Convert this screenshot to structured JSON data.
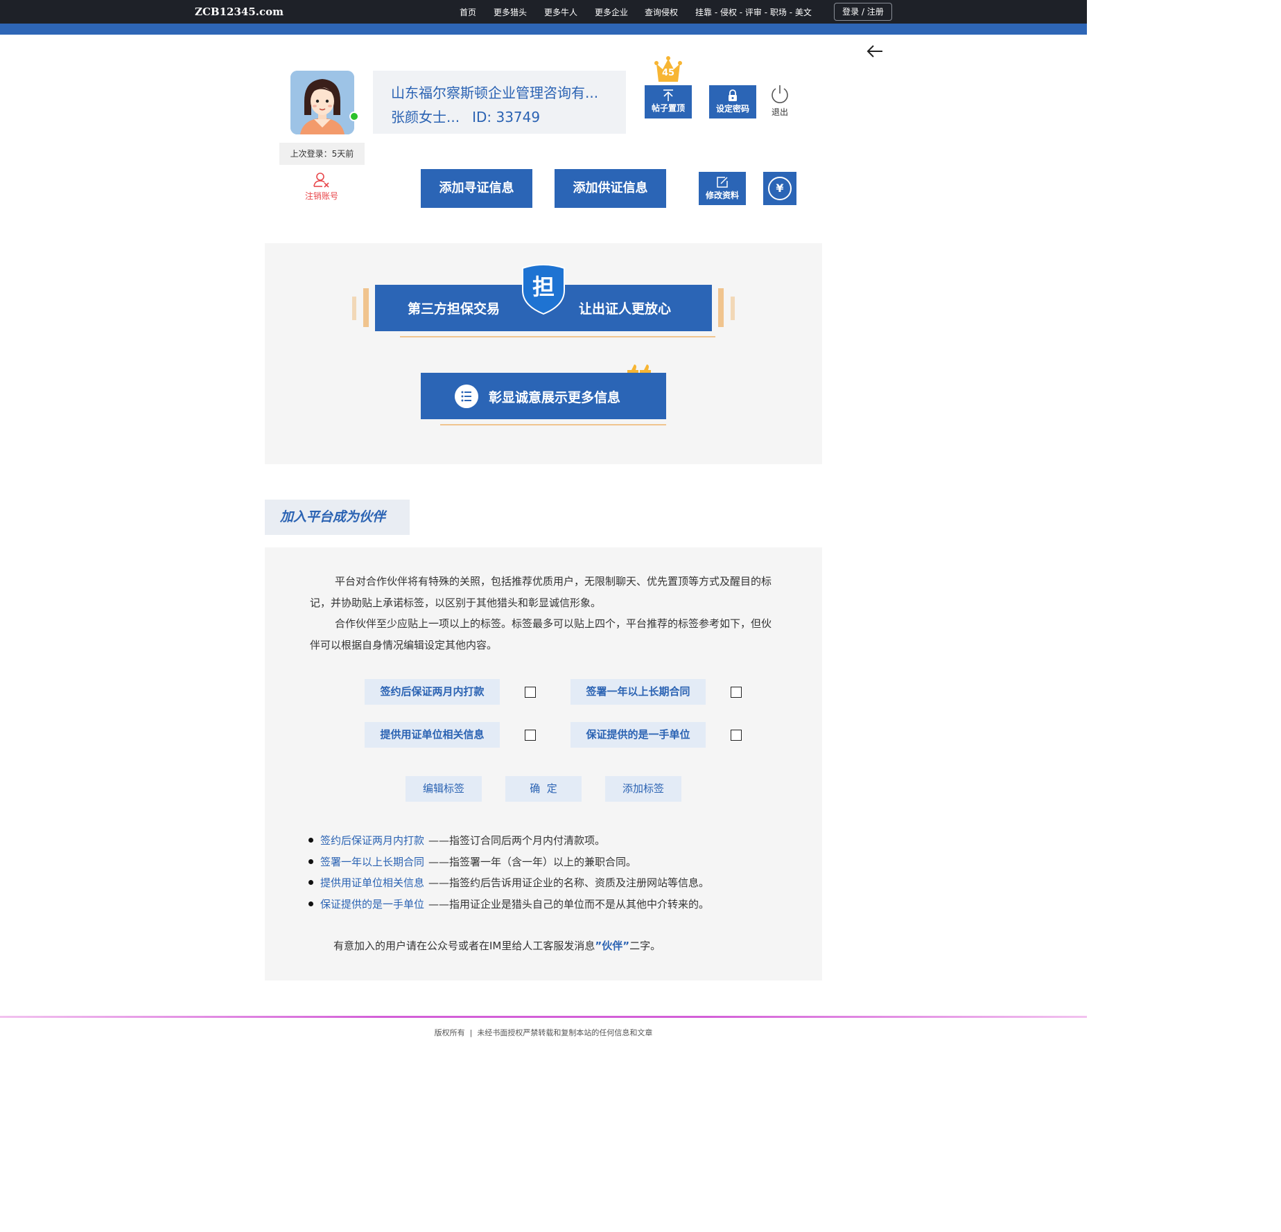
{
  "nav": {
    "logo": "ZCB12345.com",
    "items": [
      "首页",
      "更多猎头",
      "更多牛人",
      "更多企业",
      "查询侵权",
      "挂靠 - 侵权 - 评审 - 职场 - 美文"
    ],
    "login": "登录 / 注册"
  },
  "profile": {
    "company": "山东福尔察斯顿企业管理咨询有...",
    "person": "张颜女士...",
    "id": "ID: 33749",
    "last_login": "上次登录：5天前",
    "cancel_account": "注销账号",
    "crown_level": "45",
    "pin_post": "帖子置顶",
    "set_password": "设定密码",
    "logout": "退出",
    "add_seek": "添加寻证信息",
    "add_supply": "添加供证信息",
    "edit_profile": "修改资料",
    "yuan_icon": "¥"
  },
  "guarantee": {
    "left": "第三方担保交易",
    "shield_char": "担",
    "right": "让出证人更放心",
    "more_info": "彰显诚意展示更多信息"
  },
  "partner": {
    "title": "加入平台成为伙伴",
    "para1": "平台对合作伙伴将有特殊的关照，包括推荐优质用户，无限制聊天、优先置顶等方式及醒目的标记，并协助贴上承诺标签，以区别于其他猎头和彰显诚信形象。",
    "para2": "合作伙伴至少应贴上一项以上的标签。标签最多可以贴上四个，平台推荐的标签参考如下，但伙伴可以根据自身情况编辑设定其他内容。",
    "tags": [
      "签约后保证两月内打款",
      "签署一年以上长期合同",
      "提供用证单位相关信息",
      "保证提供的是一手单位"
    ],
    "buttons": [
      "编辑标签",
      "确  定",
      "添加标签"
    ],
    "definitions": [
      {
        "term": "签约后保证两月内打款",
        "desc": "——指签订合同后两个月内付清款项。"
      },
      {
        "term": "签署一年以上长期合同",
        "desc": "——指签署一年（含一年）以上的兼职合同。"
      },
      {
        "term": "提供用证单位相关信息",
        "desc": "——指签约后告诉用证企业的名称、资质及注册网站等信息。"
      },
      {
        "term": "保证提供的是一手单位",
        "desc": "——指用证企业是猎头自己的单位而不是从其他中介转来的。"
      }
    ],
    "contact_before": "有意加入的用户请在公众号或者在IM里给人工客服发消息",
    "contact_keyword": "”伙伴”",
    "contact_after": "二字。"
  },
  "footer": {
    "text": "版权所有  |  未经书面授权严禁转载和复制本站的任何信息和文章"
  }
}
